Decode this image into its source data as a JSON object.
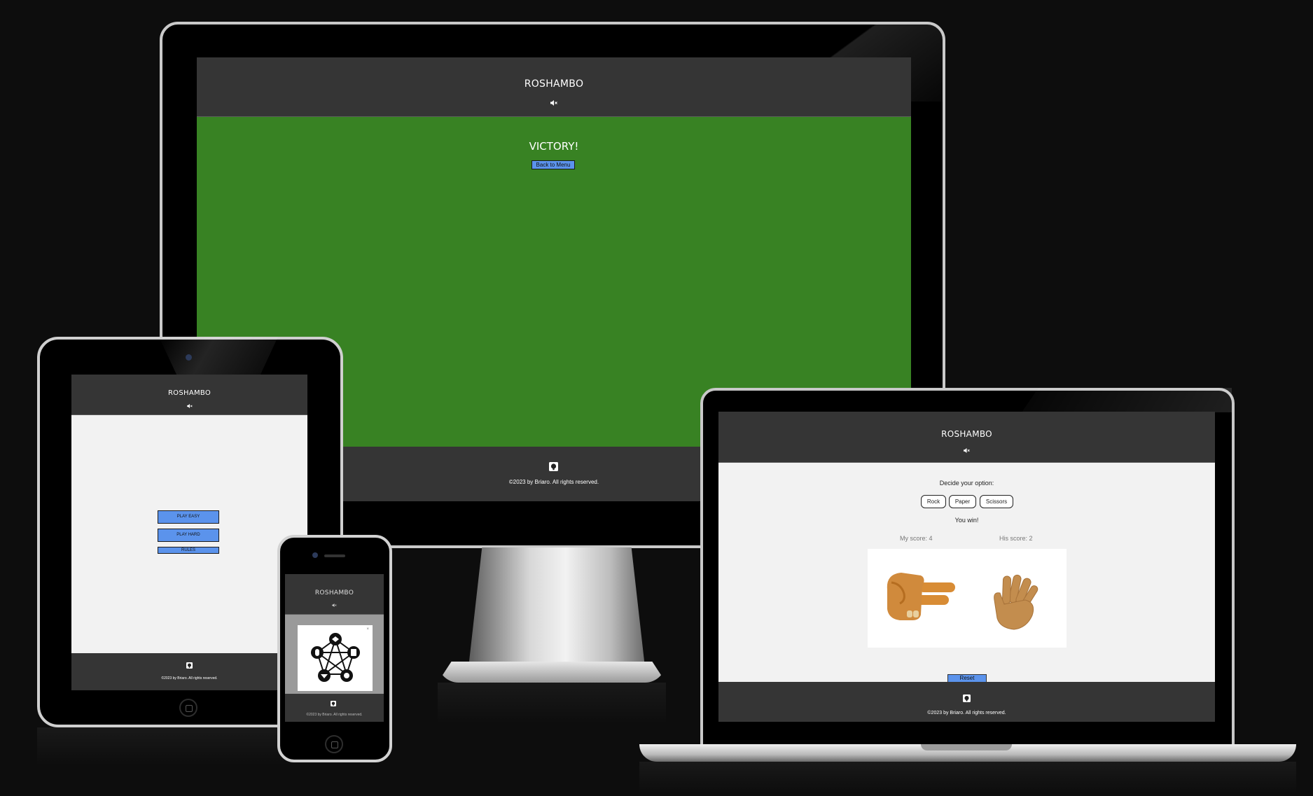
{
  "site": {
    "title": "ROSHAMBO",
    "mute_icon": "speaker-mute-icon",
    "footer_icon": "github-icon",
    "copyright": "©2023 by Briaro. All rights reserved."
  },
  "desktop": {
    "heading": "VICTORY!",
    "back_button": "Back to Menu",
    "background_color": "#388223"
  },
  "tablet": {
    "buttons": [
      "PLAY EASY",
      "PLAY HARD",
      "RULES"
    ]
  },
  "phone": {
    "modal_close": "×",
    "modal_image": "rules-diagram-icon"
  },
  "laptop": {
    "prompt": "Decide your option:",
    "options": [
      "Rock",
      "Paper",
      "Scissors"
    ],
    "result": "You win!",
    "my_score": "My score: 4",
    "his_score": "His score: 2",
    "player_hand": "scissors-hand-icon",
    "cpu_hand": "paper-hand-icon",
    "reset_button": "Reset"
  },
  "colors": {
    "header_bg": "#353535",
    "button_blue": "#5b93ec",
    "page_bg": "#f2f2f2",
    "victory_green": "#388223"
  }
}
